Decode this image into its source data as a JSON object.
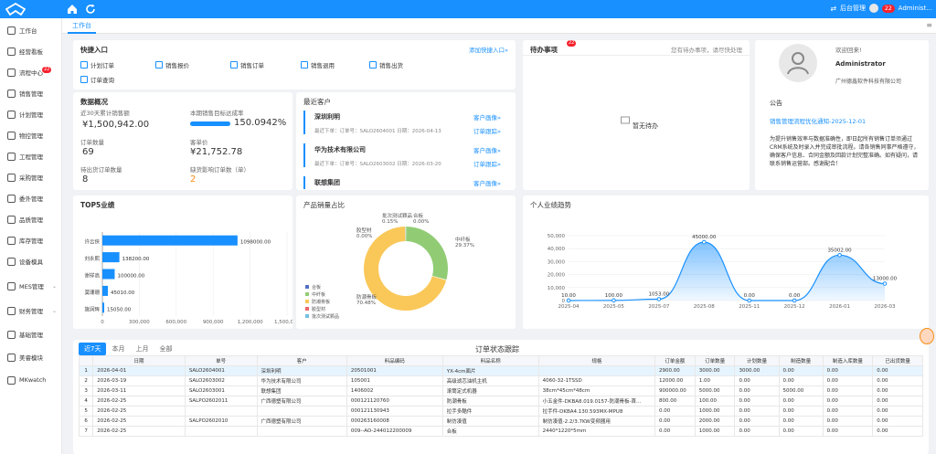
{
  "header": {
    "user_name": "Administ...",
    "backend_label": "后台管理",
    "notif_count": "22"
  },
  "tabs": [
    {
      "label": "工作台"
    }
  ],
  "sidebar": {
    "items": [
      {
        "label": "工作台"
      },
      {
        "label": "经营看板"
      },
      {
        "label": "流程中心",
        "badge": "22"
      },
      {
        "label": "销售管理"
      },
      {
        "label": "计划管理"
      },
      {
        "label": "物控管理"
      },
      {
        "label": "工程管理"
      },
      {
        "label": "采购管理"
      },
      {
        "label": "委外管理"
      },
      {
        "label": "品质管理"
      },
      {
        "label": "库存管理"
      },
      {
        "label": "设备模具"
      },
      {
        "label": "MES管理"
      },
      {
        "label": "财务管理"
      },
      {
        "label": "基础管理"
      },
      {
        "label": "美睿模块"
      },
      {
        "label": "MKwatch"
      }
    ]
  },
  "quick": {
    "title": "快捷入口",
    "add_link": "添加快捷入口»",
    "items": [
      {
        "label": "计划订单"
      },
      {
        "label": "销售报价"
      },
      {
        "label": "销售订单"
      },
      {
        "label": "销售退用"
      },
      {
        "label": "销售出货"
      },
      {
        "label": "订单查询"
      }
    ]
  },
  "overview": {
    "title": "数据概况",
    "sales_label": "近30天累计销售额",
    "sales_value": "¥1,500,942.00",
    "rate_label": "本期销售目标达成率",
    "rate_value": "150.0942%",
    "rate_fraction": 1.0,
    "orders_label": "订单数量",
    "orders_value": "69",
    "price_label": "客单价",
    "price_value": "¥21,752.78",
    "pending_label": "待出货订单数量",
    "pending_value": "8",
    "timeout_label": "缺货影响订单数（单）",
    "timeout_value": "2"
  },
  "recent": {
    "title": "最近客户",
    "customers": [
      {
        "name": "深圳利明",
        "sub": "最近下单：订单号：SALO2604001  日期：2026-04-13",
        "link1": "客户画像»",
        "link2": "订单跟踪»"
      },
      {
        "name": "华为技术有限公司",
        "sub": "最近下单：订单号：SALO2603002  日期：2026-03-20",
        "link1": "客户画像»",
        "link2": "订单跟踪»"
      },
      {
        "name": "联想集团",
        "sub": "",
        "link1": "客户画像»",
        "link2": ""
      }
    ]
  },
  "todo": {
    "title": "待办事项",
    "badge": "22",
    "hint": "您有待办事项，请尽快处理",
    "empty": "暂无待办"
  },
  "profile": {
    "welcome": "欢迎回来!",
    "name": "Administrator",
    "company": "广州德鑫软件科技有限公司",
    "notice_title": "公告",
    "notice_link": "销售管理流程优化通知-2025-12-01",
    "notice_text": "为提升销售效率与数据准确性，即日起所有销售订单须通过CRM系统及时录入并完成审批流程。请各销售同事严格遵守，确保客户信息、合同金额及回款计划完整准确。如有疑问，请联系销售运营部。感谢配合！"
  },
  "top5": {
    "title": "TOP5业绩",
    "chart_data": {
      "type": "bar",
      "categories": [
        "许云侠",
        "刘永熙",
        "谢祥高",
        "莫珊珊",
        "施润辉"
      ],
      "values": [
        1098000.0,
        138200.0,
        100000.0,
        45010.0,
        15050.0
      ],
      "value_labels": [
        "1098000.00",
        "138200.00",
        "100000.00",
        "45010.00",
        "15050.00"
      ],
      "xticks": [
        "0",
        "300,000",
        "600,000",
        "900,000",
        "1,200,000",
        "1,500,000"
      ],
      "xlim": [
        0,
        1500000
      ]
    }
  },
  "product": {
    "title": "产品销量占比",
    "chart_data": {
      "type": "pie",
      "slices": [
        {
          "name": "合板",
          "value": 0.0,
          "label": "0.00%",
          "color": "#5470c6"
        },
        {
          "name": "中纤板",
          "value": 29.37,
          "label": "29.37%",
          "color": "#91cc75"
        },
        {
          "name": "防潮骨板",
          "value": 70.48,
          "label": "70.48%",
          "color": "#fac858"
        },
        {
          "name": "胶型材",
          "value": 0.0,
          "label": "0.00%",
          "color": "#ee6666"
        },
        {
          "name": "批次测试颗品",
          "value": 0.15,
          "label": "0.15%",
          "color": "#73c0de"
        }
      ]
    }
  },
  "personal": {
    "title": "个人业绩趋势",
    "chart_data": {
      "type": "area",
      "x": [
        "2025-04",
        "2025-05",
        "2025-07",
        "2025-08",
        "2025-11",
        "2025-12",
        "2026-01",
        "2026-03"
      ],
      "y": [
        10.0,
        100.0,
        1053.0,
        45000.0,
        0.0,
        0.0,
        35002.0,
        13000.0
      ],
      "labels": [
        "10.00",
        "100.00",
        "1053.00",
        "45000.00",
        "0.00",
        "0.00",
        "35002.00",
        "13000.00"
      ],
      "yticks": [
        "0",
        "10,000",
        "20,000",
        "30,000",
        "40,000",
        "50,000"
      ],
      "ylim": [
        0,
        50000
      ]
    }
  },
  "orders": {
    "title": "订单状态跟踪",
    "tabs": [
      "近7天",
      "本月",
      "上月",
      "全部"
    ],
    "headers": [
      "日期",
      "单号",
      "客户",
      "料品编码",
      "料品名称",
      "规格",
      "订单金额",
      "订单数量",
      "计划数量",
      "制造数量",
      "制造入库数量",
      "已出货数量"
    ],
    "rows": [
      [
        "1",
        "2026-04-01",
        "SALO2604001",
        "深圳利明",
        "20501001",
        "YX-4cm面片",
        "",
        "2900.00",
        "3000.00",
        "3000.00",
        "0.00",
        "0.00",
        "0.00"
      ],
      [
        "2",
        "2026-03-19",
        "SALO2603002",
        "华为技术有限公司",
        "105001",
        "高级滤芯油机主机",
        "4060-32-1TSSD",
        "12000.00",
        "1.00",
        "0.00",
        "0.00",
        "0.00",
        "0.00"
      ],
      [
        "3",
        "2026-03-11",
        "SALO2603001",
        "联想集团",
        "1406002",
        "滚筒定式机器",
        "38cm*45cm*48cm",
        "900000.00",
        "5000.00",
        "0.00",
        "5000.00",
        "0.00",
        "0.00"
      ],
      [
        "4",
        "2026-02-25",
        "SALPO2602011",
        "广西德塑有限公司",
        "000121120760",
        "防潮骨板",
        "小五金件-DKBA8.019.0157-防潮骨板-首...",
        "800.00",
        "100.00",
        "0.00",
        "0.00",
        "0.00",
        "0.00"
      ],
      [
        "5",
        "2026-02-25",
        "",
        "",
        "000121130943",
        "拉手多酷件",
        "拉手件-DKBA4.130.593MX-MPU8",
        "0.00",
        "1000.00",
        "0.00",
        "0.00",
        "0.00",
        "0.00"
      ],
      [
        "6",
        "2026-02-25",
        "SALPO2602010",
        "广西德塑有限公司",
        "000263160008",
        "制仿凑值",
        "制仿凑值-2.2/3.7KW变频器用",
        "0.00",
        "2000.00",
        "0.00",
        "0.00",
        "0.00",
        "0.00"
      ],
      [
        "7",
        "2026-02-25",
        "",
        "",
        "009--AO-244012200009",
        "合板",
        "2440*1220*5mm",
        "0.00",
        "1000.00",
        "0.00",
        "0.00",
        "0.00",
        "0.00"
      ]
    ]
  }
}
